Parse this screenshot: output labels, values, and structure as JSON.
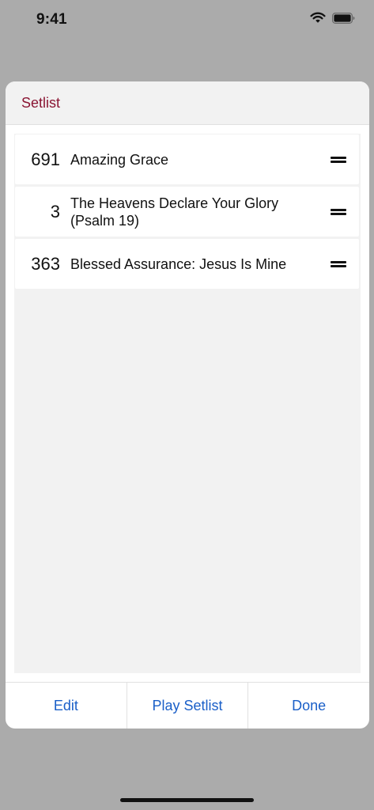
{
  "status_bar": {
    "time": "9:41",
    "icons": [
      "wifi-icon",
      "battery-icon"
    ]
  },
  "sheet": {
    "title": "Setlist",
    "title_color": "#8a1533",
    "items": [
      {
        "number": "691",
        "title": "Amazing Grace"
      },
      {
        "number": "3",
        "title": "The Heavens Declare Your Glory (Psalm 19)"
      },
      {
        "number": "363",
        "title": "Blessed Assurance: Jesus Is Mine"
      }
    ],
    "footer": {
      "edit_label": "Edit",
      "play_label": "Play Setlist",
      "done_label": "Done"
    },
    "button_color": "#1a5fc8"
  }
}
